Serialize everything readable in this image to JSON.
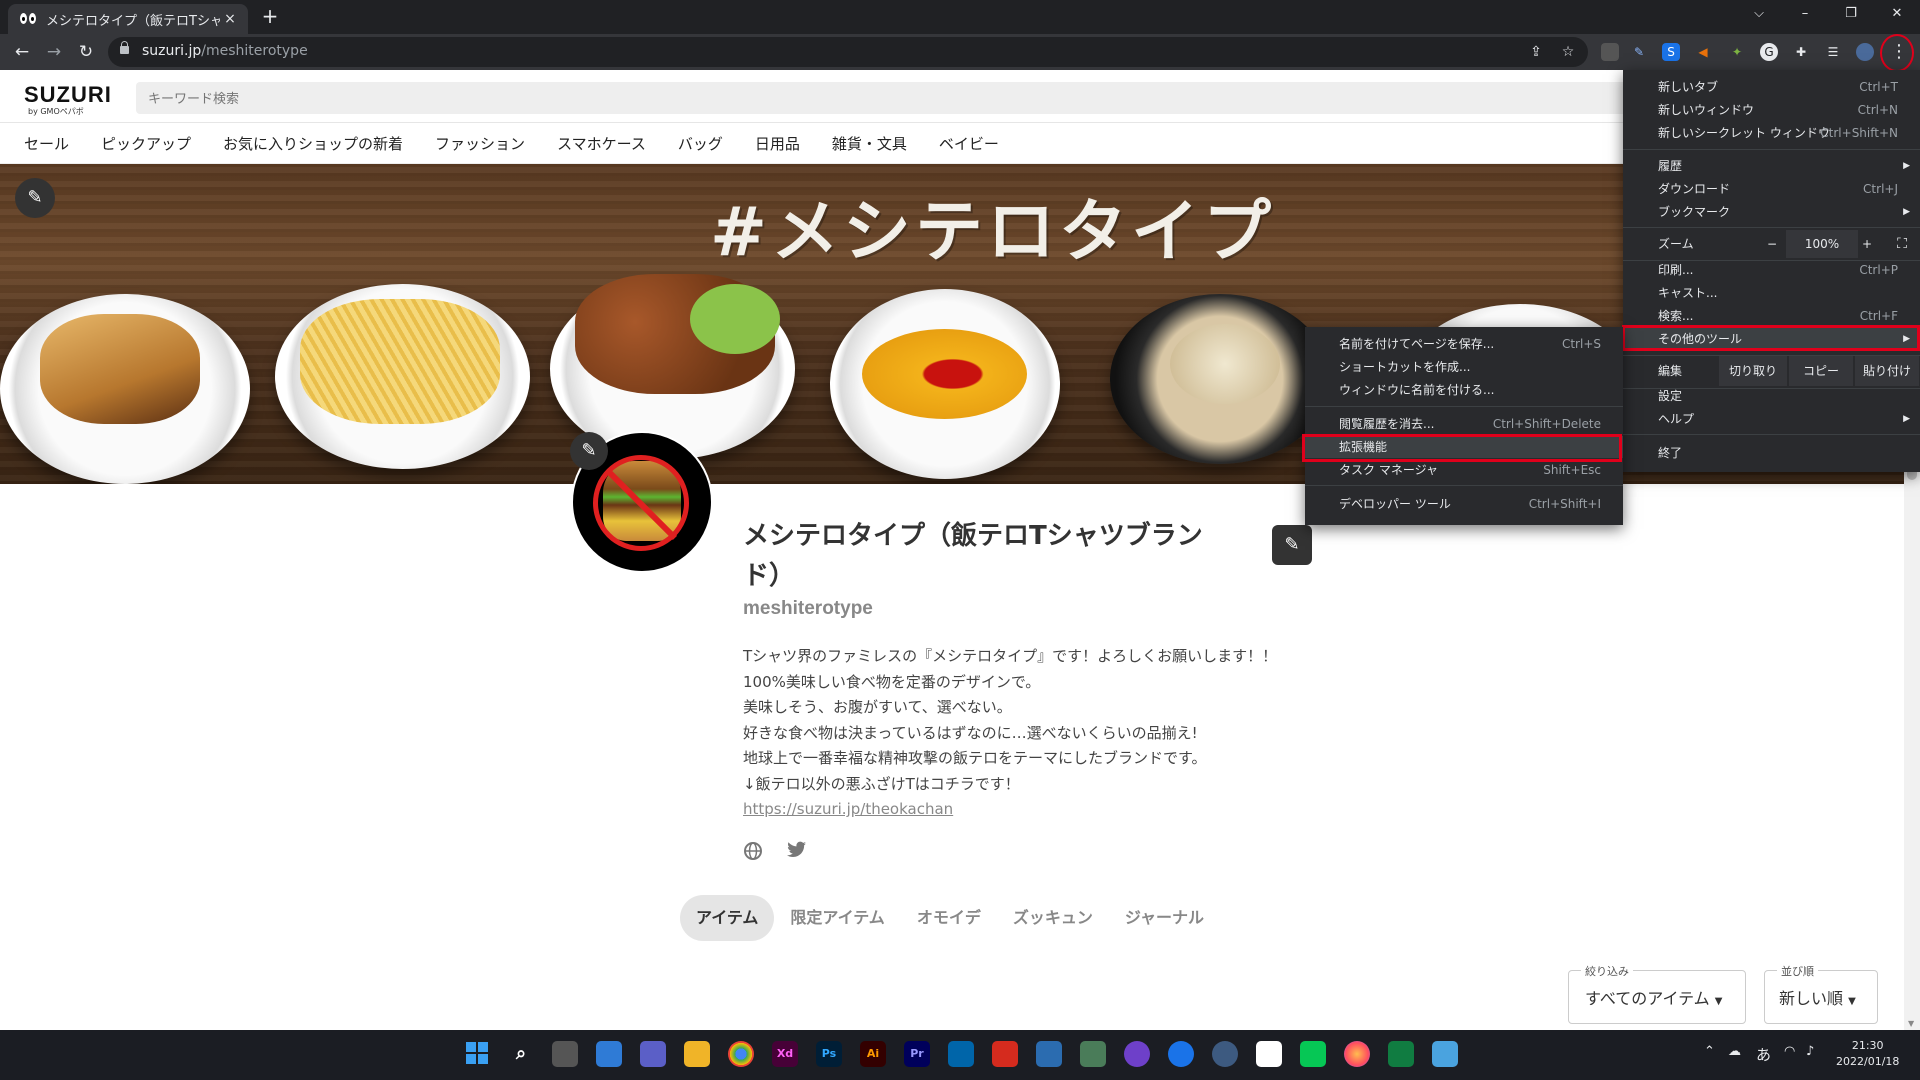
{
  "browser": {
    "tab_title": "メシテロタイプ（飯テロTシャツブランド",
    "tab_close": "×",
    "new_tab": "+",
    "window_controls": {
      "dropdown": "⌵",
      "minimize": "–",
      "restore": "❐",
      "close": "✕"
    },
    "nav": {
      "back": "←",
      "forward": "→",
      "reload": "↻"
    },
    "url_host": "suzuri.jp",
    "url_path": "/meshiterotype",
    "share_icon": "⇪",
    "star_icon": "☆",
    "menu_icon": "⋮"
  },
  "site": {
    "logo": "SUZURI",
    "logo_sub": "by GMOペパボ",
    "search_placeholder": "キーワード検索",
    "categories": [
      "セール",
      "ピックアップ",
      "お気に入りショップの新着",
      "ファッション",
      "スマホケース",
      "バッグ",
      "日用品",
      "雑貨・文具",
      "ベイビー"
    ]
  },
  "banner": {
    "title": "#メシテロタイプ"
  },
  "profile": {
    "shop_name": "メシテロタイプ（飯テロTシャツブランド）",
    "shop_id": "meshiterotype",
    "description": [
      "Tシャツ界のファミレスの『メシテロタイプ』です！よろしくお願いします！！",
      "100%美味しい食べ物を定番のデザインで。",
      "美味しそう、お腹がすいて、選べない。",
      "好きな食べ物は決まっているはずなのに…選べないくらいの品揃え!",
      "地球上で一番幸福な精神攻撃の飯テロをテーマにしたブランドです。",
      "↓飯テロ以外の悪ふざけTはコチラです！"
    ],
    "link": "https://suzuri.jp/theokachan",
    "tabs": [
      "アイテム",
      "限定アイテム",
      "オモイデ",
      "ズッキュン",
      "ジャーナル"
    ],
    "active_tab": "アイテム",
    "filter_label": "絞り込み",
    "filter_value": "すべてのアイテム",
    "sort_label": "並び順",
    "sort_value": "新しい順"
  },
  "chrome_menu": {
    "new_tab": "新しいタブ",
    "new_tab_sc": "Ctrl+T",
    "new_window": "新しいウィンドウ",
    "new_window_sc": "Ctrl+N",
    "incognito": "新しいシークレット ウィンドウ",
    "incognito_sc": "Ctrl+Shift+N",
    "history": "履歴",
    "downloads": "ダウンロード",
    "downloads_sc": "Ctrl+J",
    "bookmarks": "ブックマーク",
    "zoom": "ズーム",
    "zoom_minus": "−",
    "zoom_value": "100%",
    "zoom_plus": "+",
    "fullscreen": "⛶",
    "print": "印刷...",
    "print_sc": "Ctrl+P",
    "cast": "キャスト...",
    "find": "検索...",
    "find_sc": "Ctrl+F",
    "more_tools": "その他のツール",
    "edit": "編集",
    "cut": "切り取り",
    "copy": "コピー",
    "paste": "貼り付け",
    "settings": "設定",
    "help": "ヘルプ",
    "exit": "終了",
    "arrow": "▶"
  },
  "more_tools_menu": {
    "save_page": "名前を付けてページを保存...",
    "save_page_sc": "Ctrl+S",
    "create_shortcut": "ショートカットを作成...",
    "name_window": "ウィンドウに名前を付ける...",
    "clear_data": "閲覧履歴を消去...",
    "clear_data_sc": "Ctrl+Shift+Delete",
    "extensions": "拡張機能",
    "task_manager": "タスク マネージャ",
    "task_manager_sc": "Shift+Esc",
    "dev_tools": "デベロッパー ツール",
    "dev_tools_sc": "Ctrl+Shift+I"
  },
  "taskbar": {
    "apps": [
      "Xd",
      "Ps",
      "Ai",
      "Pr"
    ],
    "ime": "あ",
    "time": "21:30",
    "date": "2022/01/18"
  },
  "colors": {
    "highlight": "#e0001b",
    "menu_bg": "#292a2d",
    "chrome_dark": "#202124"
  }
}
